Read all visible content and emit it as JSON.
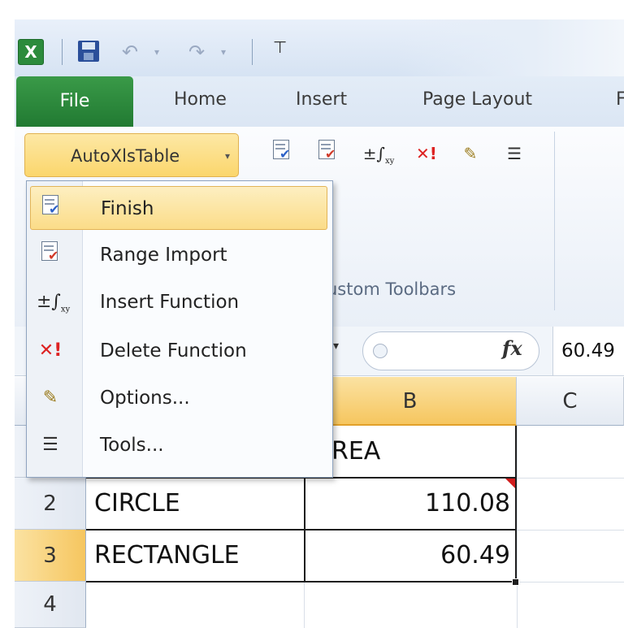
{
  "qat": {
    "app_logo": "X",
    "undo_glyph": "↶",
    "redo_glyph": "↷",
    "drop_glyph": "▾",
    "customize_glyph": "⊤"
  },
  "tabs": {
    "file": "File",
    "home": "Home",
    "insert": "Insert",
    "page_layout": "Page Layout",
    "cut_off": "F"
  },
  "ribbon": {
    "split_button_label": "AutoXlsTable",
    "split_button_caret": "▾",
    "group_label": "ustom Toolbars",
    "toolbar_icons": [
      "finish-icon",
      "range-import-icon",
      "insert-function-icon",
      "delete-function-icon",
      "options-icon",
      "tools-icon"
    ]
  },
  "menu": {
    "items": [
      {
        "label": "Finish",
        "icon": "finish-icon"
      },
      {
        "label": "Range Import",
        "icon": "range-import-icon"
      },
      {
        "label": "Insert Function",
        "icon": "insert-function-icon"
      },
      {
        "label": "Delete Function",
        "icon": "delete-function-icon"
      },
      {
        "label": "Options...",
        "icon": "options-icon"
      },
      {
        "label": "Tools...",
        "icon": "tools-icon"
      }
    ]
  },
  "formula_bar": {
    "namebox_caret": "▾",
    "fx_label": "fx",
    "value": "60.49"
  },
  "grid": {
    "columns": [
      "B",
      "C"
    ],
    "rows": [
      {
        "number": "",
        "a": "",
        "b": "REA"
      },
      {
        "number": "2",
        "a": "CIRCLE",
        "b": "110.08"
      },
      {
        "number": "3",
        "a": "RECTANGLE",
        "b": "60.49"
      },
      {
        "number": "4",
        "a": "",
        "b": ""
      }
    ]
  },
  "colors": {
    "file_tab": "#217a32",
    "selection_highlight": "#f6c65f",
    "comment_indicator": "#d21d1d"
  }
}
